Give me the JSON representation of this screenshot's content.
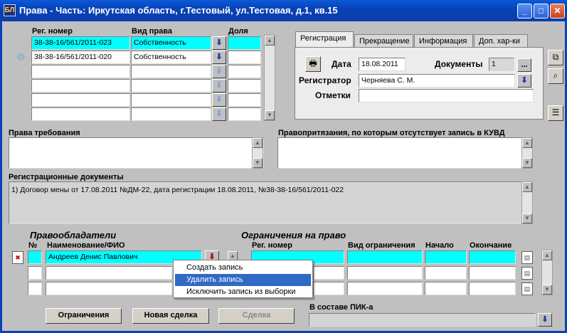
{
  "window": {
    "title": "Права - Часть: Иркутская область, г.Тестовый, ул.Тестовая, д.1, кв.15",
    "app_icon_glyph": "БЛ",
    "minimize_glyph": "_",
    "maximize_glyph": "□",
    "close_glyph": "✕"
  },
  "rights": {
    "headers": {
      "reg_number": "Рег. номер",
      "right_type": "Вид права",
      "share": "Доля"
    },
    "rows": [
      {
        "reg_number": "38-38-16/561/2011-023",
        "right_type": "Собственность",
        "share": ""
      },
      {
        "reg_number": "38-38-16/561/2011-020",
        "right_type": "Собственность",
        "share": ""
      },
      {
        "reg_number": "",
        "right_type": "",
        "share": ""
      },
      {
        "reg_number": "",
        "right_type": "",
        "share": ""
      },
      {
        "reg_number": "",
        "right_type": "",
        "share": ""
      },
      {
        "reg_number": "",
        "right_type": "",
        "share": ""
      }
    ],
    "row2_icon": "recycle-bin-icon"
  },
  "tabs": [
    {
      "label": "Регистрация",
      "active": true
    },
    {
      "label": "Прекращение",
      "active": false
    },
    {
      "label": "Информация",
      "active": false
    },
    {
      "label": "Доп. хар-ки",
      "active": false
    }
  ],
  "registration": {
    "date_label": "Дата",
    "date_value": "18.08.2011",
    "documents_label": "Документы",
    "documents_count": "1",
    "documents_button": "...",
    "registrar_label": "Регистратор",
    "registrar_value": "Черняева С. М.",
    "notes_label": "Отметки",
    "notes_value": ""
  },
  "requirements": {
    "label": "Права требования"
  },
  "claims": {
    "label": "Правопритязания, по которым отсутствует запись в КУВД"
  },
  "reg_docs": {
    "label": "Регистрационные документы",
    "text": "1) Договор мены от 17.08.2011 №ДМ-22, дата регистрации 18.08.2011, №38-38-16/561/2011-022"
  },
  "holders": {
    "section_title": "Правообладатели",
    "headers": {
      "num": "№",
      "name": "Наименование/ФИО"
    },
    "rows": [
      {
        "num": "",
        "name": "Андреев Денис Павлович"
      },
      {
        "num": "",
        "name": ""
      },
      {
        "num": "",
        "name": ""
      }
    ]
  },
  "restrictions": {
    "section_title": "Ограничения на право",
    "headers": {
      "reg_number": "Рег. номер",
      "type": "Вид ограничения",
      "start": "Начало",
      "end": "Окончание"
    }
  },
  "context_menu": {
    "items": [
      {
        "label": "Создать запись",
        "selected": false
      },
      {
        "label": "Удалить запись",
        "selected": true
      },
      {
        "label": "Исключить запись из выборки",
        "selected": false
      }
    ]
  },
  "buttons": {
    "restrictions": "Ограничения",
    "new_deal": "Новая сделка",
    "deal": "Сделка"
  },
  "pik": {
    "label": "В составе ПИК-а",
    "value": ""
  },
  "colors": {
    "highlight": "#00ffff",
    "selection": "#316ac5",
    "titlebar": "#0842b8"
  }
}
